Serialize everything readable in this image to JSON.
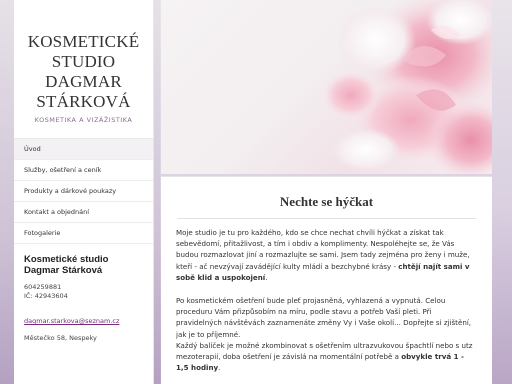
{
  "site": {
    "title_lines": [
      "KOSMETICKÉ",
      "STUDIO",
      "DAGMAR",
      "STÁRKOVÁ"
    ],
    "subtitle": "KOSMETIKA A VIZÁŽISTIKA"
  },
  "nav": {
    "items": [
      {
        "label": "Úvod"
      },
      {
        "label": "Služby, ošetření a ceník"
      },
      {
        "label": "Produkty a dárkové poukazy"
      },
      {
        "label": "Kontakt a objednání"
      },
      {
        "label": "Fotogalerie"
      }
    ]
  },
  "contact": {
    "name_line1": "Kosmetické studio",
    "name_line2": "Dagmar Stárková",
    "phone": "604259881",
    "ic": "IČ: 42943604",
    "email": "dagmar.starkova@seznam.cz",
    "address": "Městečko 58, Nespeky"
  },
  "main": {
    "heading": "Nechte se hýčkat",
    "p1_text": "Moje studio je tu pro každého, kdo se chce nechat chvíli hýčkat a získat tak sebevědomí, přitažlivost, a tím i obdiv a komplimenty. Nespoléhejte se, že Vás budou rozmazlovat jiní a rozmazlujte se sami. Jsem tady zejména pro ženy i muže, kteří - ač nevzývají zavádějící kulty mládí a bezchybné krásy - ",
    "p1_bold": "chtějí najít  sami v sobě klid a uspokojení",
    "p1_end": ".",
    "p2_text": "Po kosmetickém ošetření bude pleť projasněná, vyhlazená a vypnutá. Celou proceduru Vám přizpůsobím na míru, podle stavu a potřeb Vaší pleti. Při pravidelných návštěvách zaznamenáte změny Vy i Vaše okolí... Dopřejte si zjištění, jak je to příjemné.",
    "p3_text": "Každý balíček je možné zkombinovat s ošetřením ultrazvukovou špachtlí nebo s utz mezoterapií, doba ošetření je závislá na momentální potřebě a ",
    "p3_bold": "obvykle trvá 1 - 1,5 hodiny",
    "p3_end": "."
  },
  "colors": {
    "accent": "#7b2b7c",
    "background": "#d9cfe0",
    "petal_pink": "#f1b8c8"
  },
  "icons": {
    "hero": "peony-flowers-image"
  }
}
